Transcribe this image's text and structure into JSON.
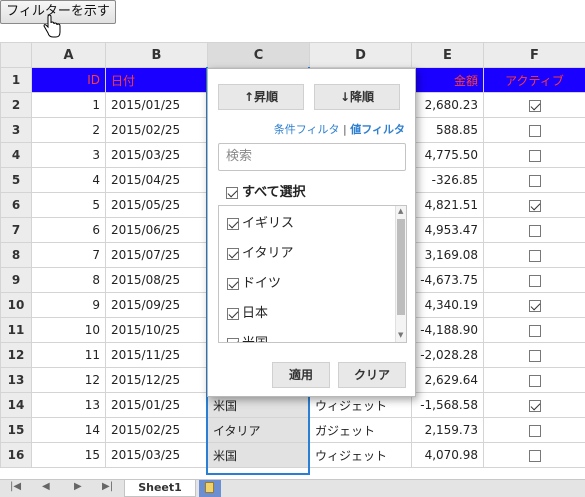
{
  "toolbar": {
    "show_filter_label": "フィルターを示す"
  },
  "grid": {
    "columns": [
      "A",
      "B",
      "C",
      "D",
      "E",
      "F"
    ],
    "header_row": {
      "row_num": "1",
      "id": "ID",
      "date": "日付",
      "amount": "金額",
      "active": "アクティブ"
    },
    "rows": [
      {
        "n": "2",
        "id": "1",
        "date": "2015/01/25",
        "c": "",
        "d": "",
        "amount": "2,680.23",
        "active": true
      },
      {
        "n": "3",
        "id": "2",
        "date": "2015/02/25",
        "c": "",
        "d": "",
        "amount": "588.85",
        "active": false
      },
      {
        "n": "4",
        "id": "3",
        "date": "2015/03/25",
        "c": "",
        "d": "",
        "amount": "4,775.50",
        "active": false
      },
      {
        "n": "5",
        "id": "4",
        "date": "2015/04/25",
        "c": "",
        "d": "",
        "amount": "-326.85",
        "active": false
      },
      {
        "n": "6",
        "id": "5",
        "date": "2015/05/25",
        "c": "",
        "d": "",
        "amount": "4,821.51",
        "active": true
      },
      {
        "n": "7",
        "id": "6",
        "date": "2015/06/25",
        "c": "",
        "d": "",
        "amount": "4,953.47",
        "active": false
      },
      {
        "n": "8",
        "id": "7",
        "date": "2015/07/25",
        "c": "",
        "d": "",
        "amount": "3,169.08",
        "active": false
      },
      {
        "n": "9",
        "id": "8",
        "date": "2015/08/25",
        "c": "",
        "d": "",
        "amount": "-4,673.75",
        "active": false
      },
      {
        "n": "10",
        "id": "9",
        "date": "2015/09/25",
        "c": "",
        "d": "",
        "amount": "4,340.19",
        "active": true
      },
      {
        "n": "11",
        "id": "10",
        "date": "2015/10/25",
        "c": "",
        "d": "",
        "amount": "-4,188.90",
        "active": false
      },
      {
        "n": "12",
        "id": "11",
        "date": "2015/11/25",
        "c": "",
        "d": "",
        "amount": "-2,028.28",
        "active": false
      },
      {
        "n": "13",
        "id": "12",
        "date": "2015/12/25",
        "c": "",
        "d": "",
        "amount": "2,629.64",
        "active": false
      },
      {
        "n": "14",
        "id": "13",
        "date": "2015/01/25",
        "c": "米国",
        "d": "ウィジェット",
        "amount": "-1,568.58",
        "active": true
      },
      {
        "n": "15",
        "id": "14",
        "date": "2015/02/25",
        "c": "イタリア",
        "d": "ガジェット",
        "amount": "2,159.73",
        "active": false
      },
      {
        "n": "16",
        "id": "15",
        "date": "2015/03/25",
        "c": "米国",
        "d": "ウィジェット",
        "amount": "4,070.98",
        "active": false
      }
    ]
  },
  "filter_popup": {
    "sort_asc": "↑昇順",
    "sort_desc": "↓降順",
    "condition_filter": "条件フィルタ",
    "separator": "|",
    "value_filter": "値フィルタ",
    "search_placeholder": "検索",
    "select_all": "すべて選択",
    "items": [
      "イギリス",
      "イタリア",
      "ドイツ",
      "日本",
      "米国"
    ],
    "apply": "適用",
    "clear": "クリア"
  },
  "sheet_tabs": {
    "active": "Sheet1"
  },
  "colors": {
    "header_bg": "#1a00ff",
    "header_text": "#ff3b3b",
    "selection": "#2a7fd4"
  }
}
